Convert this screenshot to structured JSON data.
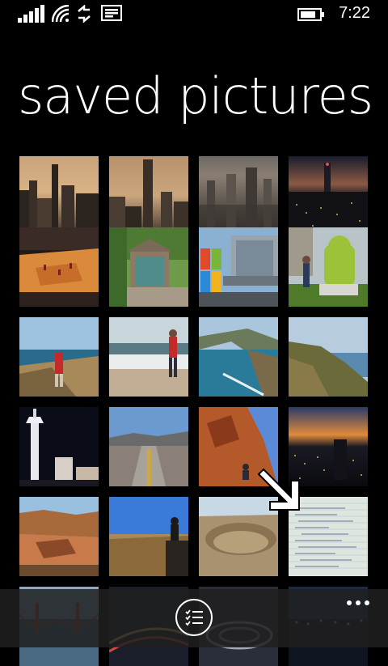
{
  "status_bar": {
    "time": "7:22",
    "icons": [
      "signal-icon",
      "wifi-icon",
      "data-sync-icon",
      "message-icon",
      "battery-icon"
    ]
  },
  "page": {
    "title": "saved pictures"
  },
  "photos": [
    {
      "name": "nyc-skyline-1"
    },
    {
      "name": "nyc-empire-state"
    },
    {
      "name": "nyc-aerial"
    },
    {
      "name": "nyc-night"
    },
    {
      "name": "basketball-arena"
    },
    {
      "name": "garage-door"
    },
    {
      "name": "microsoft-building"
    },
    {
      "name": "android-statue"
    },
    {
      "name": "rocky-coast-person"
    },
    {
      "name": "beach-person"
    },
    {
      "name": "coastline-aerial"
    },
    {
      "name": "coastal-hills"
    },
    {
      "name": "stratosphere-tower"
    },
    {
      "name": "desert-road"
    },
    {
      "name": "red-rock-person"
    },
    {
      "name": "city-night-view"
    },
    {
      "name": "grand-canyon"
    },
    {
      "name": "canyon-person-sitting"
    },
    {
      "name": "meteor-crater"
    },
    {
      "name": "handwritten-notes"
    },
    {
      "name": "golden-gate-bridge"
    },
    {
      "name": "highway-night"
    },
    {
      "name": "interchange-night"
    },
    {
      "name": "waterfront-night"
    }
  ],
  "app_bar": {
    "select_button": "select-list-icon",
    "more_button": "more-options-icon"
  }
}
